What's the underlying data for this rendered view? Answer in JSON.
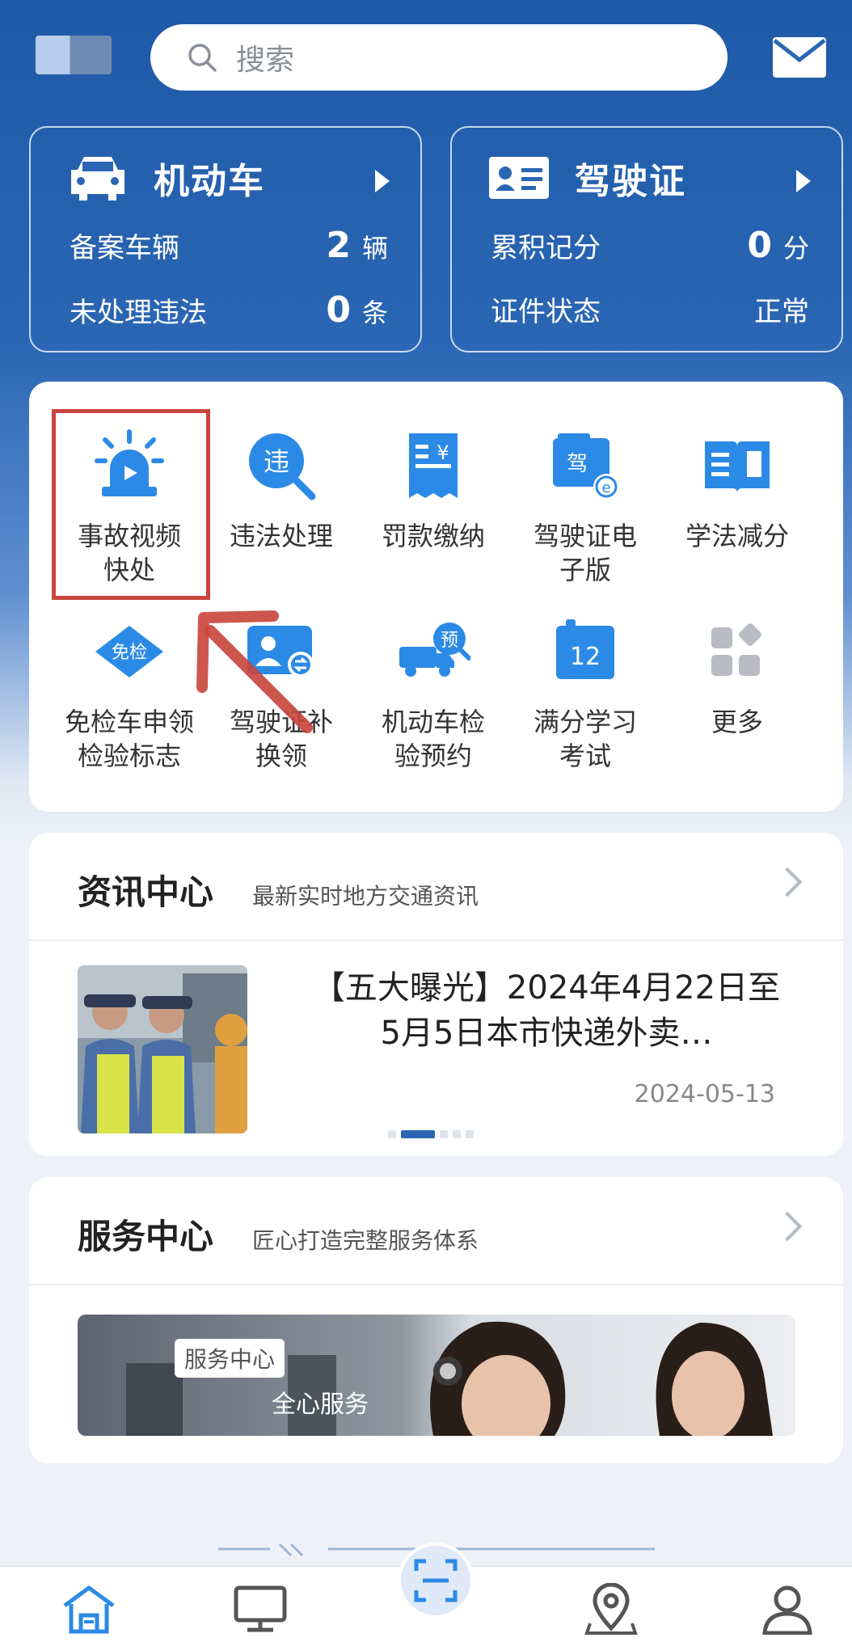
{
  "header": {
    "search_placeholder": "搜索",
    "icons": [
      "search-icon",
      "mail-icon"
    ]
  },
  "vehicle_card": {
    "title": "机动车",
    "rows": [
      {
        "label": "备案车辆",
        "value": "2",
        "unit": "辆"
      },
      {
        "label": "未处理违法",
        "value": "0",
        "unit": "条"
      }
    ]
  },
  "license_card": {
    "title": "驾驶证",
    "rows": [
      {
        "label": "累积记分",
        "value": "0",
        "unit": "分"
      },
      {
        "label": "证件状态",
        "value": "正常",
        "unit": ""
      }
    ]
  },
  "services": [
    {
      "label": "事故视频\n快处",
      "icon": "alarm-video-icon"
    },
    {
      "label": "违法处理",
      "icon": "violation-search-icon"
    },
    {
      "label": "罚款缴纳",
      "icon": "receipt-yen-icon"
    },
    {
      "label": "驾驶证电\n子版",
      "icon": "e-license-icon"
    },
    {
      "label": "学法减分",
      "icon": "book-icon"
    },
    {
      "label": "免检车申领\n检验标志",
      "icon": "exempt-badge-icon"
    },
    {
      "label": "驾驶证补\n换领",
      "icon": "license-renew-icon"
    },
    {
      "label": "机动车检\n验预约",
      "icon": "truck-appointment-icon"
    },
    {
      "label": "满分学习\n考试",
      "icon": "calendar-12-icon"
    },
    {
      "label": "更多",
      "icon": "more-grid-icon"
    }
  ],
  "news": {
    "title": "资讯中心",
    "subtitle": "最新实时地方交通资讯",
    "headline": "【五大曝光】2024年4月22日至5月5日本市快递外卖…",
    "date": "2024-05-13",
    "carousel_active_index": 1,
    "carousel_count": 5
  },
  "service_center": {
    "title": "服务中心",
    "subtitle": "匠心打造完整服务体系",
    "banner_tag": "服务中心",
    "banner_slogan": "全心服务"
  },
  "bottom_nav": {
    "icons": [
      "home-icon",
      "monitor-icon",
      "scan-icon",
      "map-pin-icon",
      "user-icon"
    ]
  },
  "colors": {
    "brand_blue": "#2a66b4",
    "highlight_red": "#c8453c",
    "icon_blue": "#2b8ae6"
  }
}
